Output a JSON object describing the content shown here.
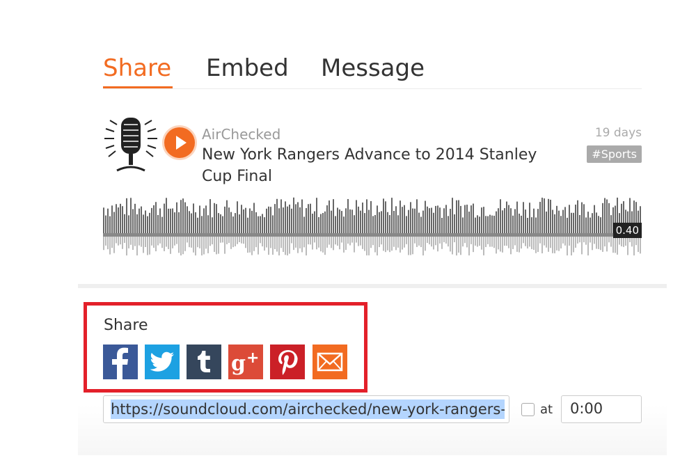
{
  "tabs": [
    {
      "label": "Share",
      "active": true
    },
    {
      "label": "Embed",
      "active": false
    },
    {
      "label": "Message",
      "active": false
    }
  ],
  "track": {
    "uploader": "AirChecked",
    "title": "New York Rangers Advance to 2014 Stanley Cup Final",
    "age": "19 days",
    "tag": "#Sports",
    "time": "0.40",
    "artwork_icon": "microphone-icon",
    "play_icon": "play-icon"
  },
  "share": {
    "label": "Share",
    "networks": [
      {
        "name": "facebook",
        "icon": "facebook-icon",
        "color": "#3b5998"
      },
      {
        "name": "twitter",
        "icon": "twitter-icon",
        "color": "#1da1e2"
      },
      {
        "name": "tumblr",
        "icon": "tumblr-icon",
        "color": "#35465c"
      },
      {
        "name": "google-plus",
        "icon": "google-plus-icon",
        "color": "#dc4b38"
      },
      {
        "name": "pinterest",
        "icon": "pinterest-icon",
        "color": "#cb2027"
      },
      {
        "name": "email",
        "icon": "email-icon",
        "color": "#f26b21"
      }
    ],
    "url": "https://soundcloud.com/airchecked/new-york-rangers-t",
    "at_label": "at",
    "at_checked": false,
    "start_time": "0:00"
  },
  "colors": {
    "accent": "#f26b21",
    "highlight_border": "#e3202a",
    "selection": "#b4d5fe"
  }
}
